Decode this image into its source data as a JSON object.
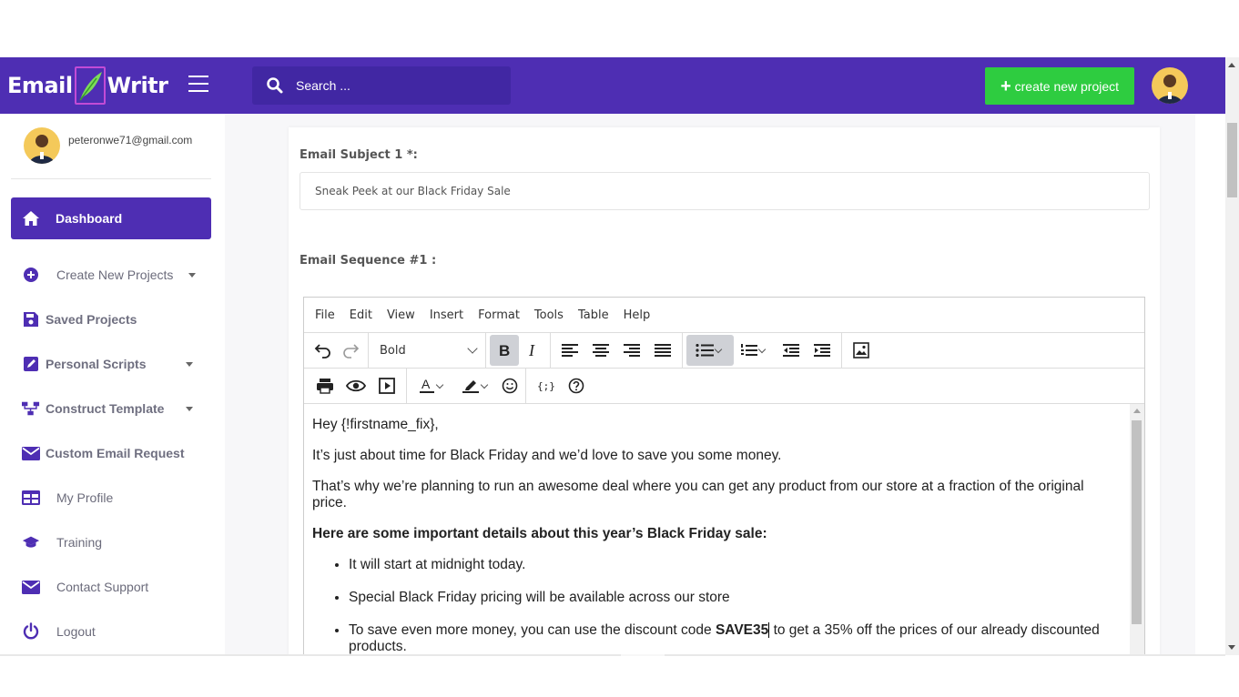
{
  "header": {
    "logo_left": "Email",
    "logo_right": "Writr",
    "search_placeholder": "Search ...",
    "new_project_label": "create new project"
  },
  "sidebar": {
    "email": "peteronwe71@gmail.com",
    "items": [
      {
        "label": "Dashboard",
        "icon": "home-icon"
      },
      {
        "label": "Create New Projects",
        "icon": "plus-circle-icon"
      },
      {
        "label": "Saved Projects",
        "icon": "save-icon"
      },
      {
        "label": "Personal Scripts",
        "icon": "edit-icon"
      },
      {
        "label": "Construct Template",
        "icon": "sitemap-icon"
      },
      {
        "label": "Custom Email Request",
        "icon": "envelope-icon"
      },
      {
        "label": "My Profile",
        "icon": "table-icon"
      },
      {
        "label": "Training",
        "icon": "graduation-cap-icon"
      },
      {
        "label": "Contact Support",
        "icon": "envelope-icon"
      },
      {
        "label": "Logout",
        "icon": "power-icon"
      }
    ]
  },
  "form": {
    "subject_label": "Email Subject 1 *:",
    "subject_value": "Sneak Peek at our Black Friday Sale",
    "sequence_label": "Email Sequence #1 :"
  },
  "editor": {
    "menu": [
      "File",
      "Edit",
      "View",
      "Insert",
      "Format",
      "Tools",
      "Table",
      "Help"
    ],
    "block_format": "Bold",
    "content": {
      "greeting": "Hey {!firstname_fix},",
      "p1": "It’s just about time for Black Friday and we’d love to save you some money.",
      "p2": "That’s why we’re planning to run an awesome deal where you can get any product from our store at a fraction of the original price.",
      "heading": "Here are some important details about this year’s Black Friday sale:",
      "bullet1": "It will start at midnight today.",
      "bullet2": "Special Black Friday pricing will be available across our store",
      "bullet3_pre": "To save even more money, you can use the discount code ",
      "bullet3_code": "SAVE35",
      "bullet3_post": " to get a 35% off the prices of our already discounted products."
    }
  },
  "colors": {
    "brand": "#4e2eb3",
    "success": "#2ecc40"
  }
}
